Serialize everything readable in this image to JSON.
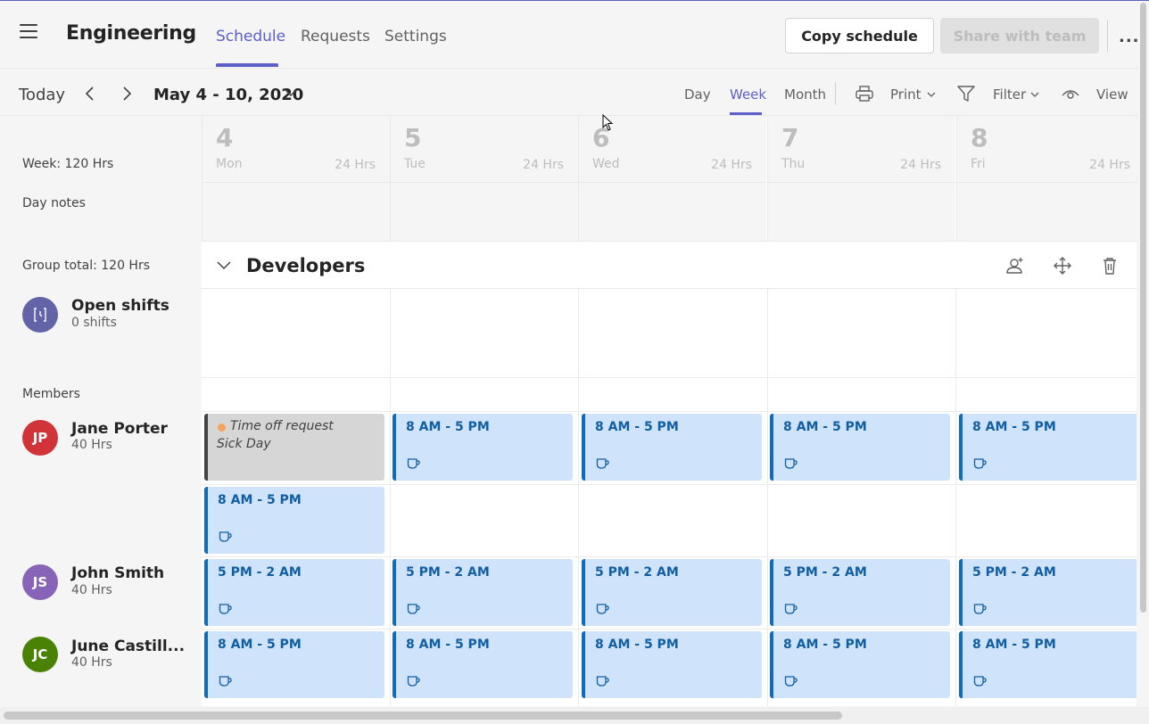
{
  "header": {
    "team_name": "Engineering",
    "tabs": [
      "Schedule",
      "Requests",
      "Settings"
    ],
    "copy_schedule": "Copy schedule",
    "share_with_team": "Share with team",
    "more": "..."
  },
  "toolbar": {
    "today": "Today",
    "date_range": "May 4 - 10, 2020",
    "views": [
      "Day",
      "Week",
      "Month"
    ],
    "active_view": "Week",
    "print": "Print",
    "filter": "Filter",
    "view": "View"
  },
  "left": {
    "week_total": "Week: 120 Hrs",
    "day_notes": "Day notes",
    "group_total": "Group total: 120 Hrs",
    "open_shifts_label": "Open shifts",
    "open_shifts_count": "0 shifts",
    "members_label": "Members"
  },
  "days": [
    {
      "num": "4",
      "name": "Mon",
      "hrs": "24 Hrs"
    },
    {
      "num": "5",
      "name": "Tue",
      "hrs": "24 Hrs"
    },
    {
      "num": "6",
      "name": "Wed",
      "hrs": "24 Hrs"
    },
    {
      "num": "7",
      "name": "Thu",
      "hrs": "24 Hrs"
    },
    {
      "num": "8",
      "name": "Fri",
      "hrs": "24 Hrs"
    }
  ],
  "group": {
    "name": "Developers"
  },
  "members": [
    {
      "initials": "JP",
      "name": "Jane Porter",
      "hrs": "40 Hrs",
      "color": "#d13438"
    },
    {
      "initials": "JS",
      "name": "John Smith",
      "hrs": "40 Hrs",
      "color": "#8764b8"
    },
    {
      "initials": "JC",
      "name": "June Castill...",
      "hrs": "40 Hrs",
      "color": "#498205"
    }
  ],
  "open_shift_avatar_color": "#6264a7",
  "time_off": {
    "label": "Time off request",
    "reason": "Sick Day"
  },
  "shifts": {
    "jane_row1": [
      "8 AM - 5 PM",
      "8 AM - 5 PM",
      "8 AM - 5 PM",
      "8 AM - 5 PM"
    ],
    "jane_row2": [
      "8 AM - 5 PM"
    ],
    "john": [
      "5 PM - 2 AM",
      "5 PM - 2 AM",
      "5 PM - 2 AM",
      "5 PM - 2 AM",
      "5 PM - 2 AM"
    ],
    "june": [
      "8 AM - 5 PM",
      "8 AM - 5 PM",
      "8 AM - 5 PM",
      "8 AM - 5 PM",
      "8 AM - 5 PM"
    ]
  },
  "colors": {
    "accent": "#5b5fc7",
    "shift_bg": "#cfe4fa",
    "shift_border": "#0f6cbd",
    "timeoff_bg": "#d6d6d6"
  }
}
